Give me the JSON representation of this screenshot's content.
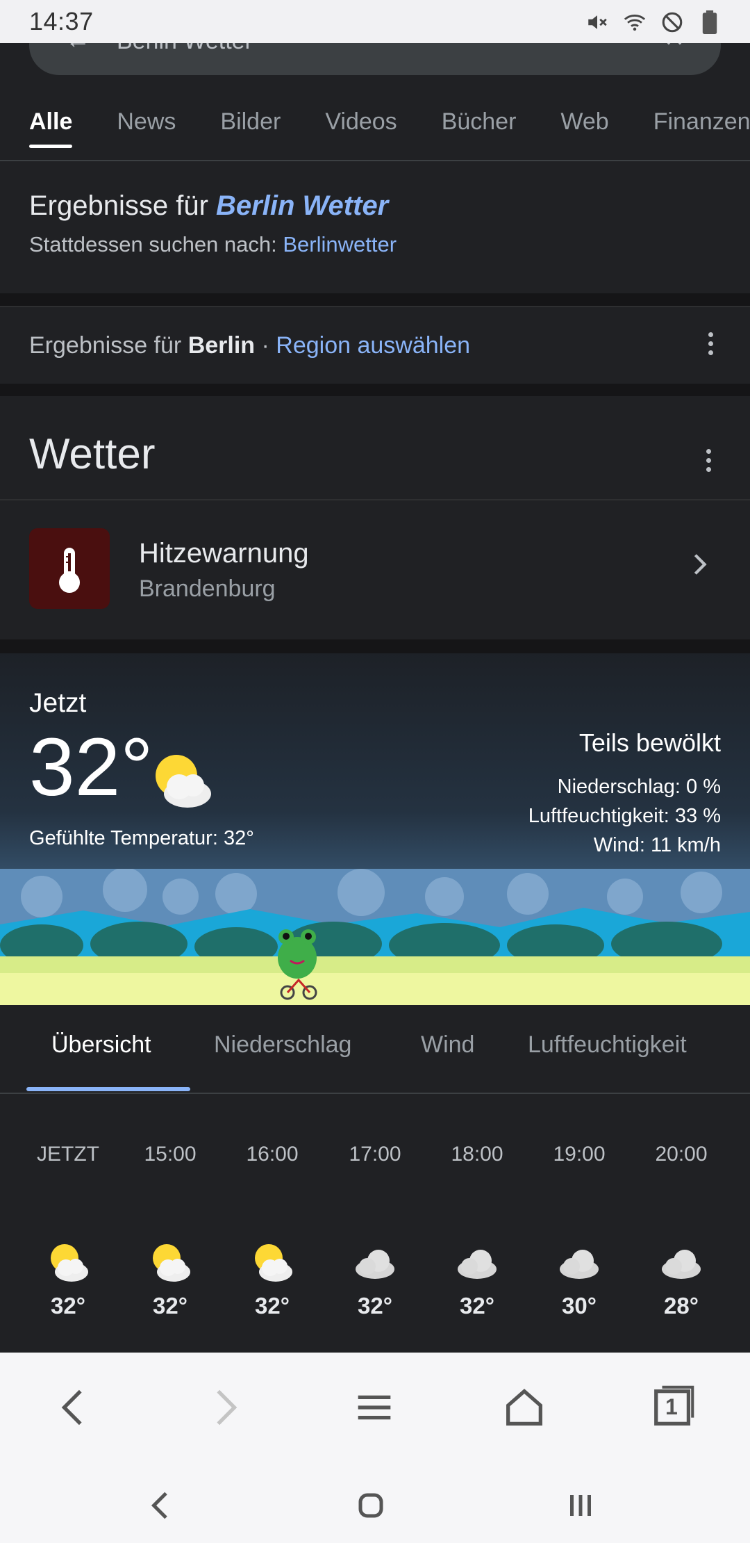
{
  "status_bar": {
    "time": "14:37"
  },
  "search": {
    "query": "Berlin Wetter"
  },
  "tabs": [
    "Alle",
    "News",
    "Bilder",
    "Videos",
    "Bücher",
    "Web",
    "Finanzen"
  ],
  "correction": {
    "prefix": "Ergebnisse für",
    "query": "Berlin Wetter",
    "alt_prefix": "Stattdessen suchen nach:",
    "alt_query": "Berlinwetter"
  },
  "region": {
    "prefix": "Ergebnisse für",
    "place": "Berlin",
    "dot": " · ",
    "link": "Region auswählen"
  },
  "weather": {
    "title": "Wetter",
    "alert": {
      "title": "Hitzewarnung",
      "region": "Brandenburg"
    },
    "now": {
      "label": "Jetzt",
      "temp": "32°",
      "feels": "Gefühlte Temperatur: 32°",
      "condition": "Teils bewölkt",
      "precip": "Niederschlag: 0 %",
      "humidity": "Luftfeuchtigkeit: 33 %",
      "wind": "Wind: 11 km/h"
    },
    "tabs": [
      "Übersicht",
      "Niederschlag",
      "Wind",
      "Luftfeuchtigkeit"
    ],
    "hourly": [
      {
        "time": "JETZT",
        "temp": "32°",
        "icon": "partly-cloudy-icon"
      },
      {
        "time": "15:00",
        "temp": "32°",
        "icon": "partly-cloudy-icon"
      },
      {
        "time": "16:00",
        "temp": "32°",
        "icon": "partly-cloudy-icon"
      },
      {
        "time": "17:00",
        "temp": "32°",
        "icon": "cloudy-icon"
      },
      {
        "time": "18:00",
        "temp": "32°",
        "icon": "cloudy-icon"
      },
      {
        "time": "19:00",
        "temp": "30°",
        "icon": "cloudy-icon"
      },
      {
        "time": "20:00",
        "temp": "28°",
        "icon": "cloudy-icon"
      }
    ]
  },
  "browser_bar": {
    "tab_count": "1"
  },
  "colors": {
    "link": "#8ab4f8",
    "background": "#202124",
    "alert_badge": "#4a0f0f"
  }
}
